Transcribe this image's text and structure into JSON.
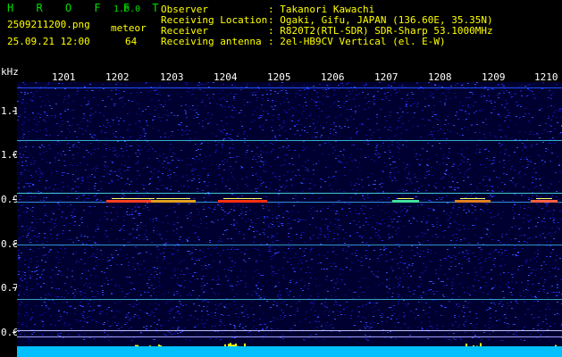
{
  "app": {
    "title": "H R O F F T",
    "version": "1.0.0",
    "filename": "2509211200.png",
    "datetime": "25.09.21 12:00",
    "mode_label": "meteor",
    "count": "64"
  },
  "info": {
    "observer_label": "Observer",
    "observer_value": ": Takanori Kawachi",
    "location_label": "Receiving Location",
    "location_value": ": Ogaki, Gifu, JAPAN (136.60E, 35.35N)",
    "receiver_label": "Receiver",
    "receiver_value": ": R820T2(RTL-SDR) SDR-Sharp 53.1000MHz",
    "antenna_label": "Receiving antenna",
    "antenna_value": ": 2el-HB9CV Vertical (el. E-W)"
  },
  "axis": {
    "y_unit": "kHz",
    "x_ticks": [
      "1201",
      "1202",
      "1203",
      "1204",
      "1205",
      "1206",
      "1207",
      "1208",
      "1209",
      "1210"
    ],
    "y_ticks": [
      "1.1",
      "1.0",
      "0.9",
      "0.8",
      "0.7",
      "0.6"
    ]
  },
  "colors": {
    "background": "#000000",
    "noise": "#1010a0",
    "carrier": "#40d0d0",
    "echo": "#ff4020",
    "activity": "#ffff00",
    "grid_dot": "#4080ff"
  }
}
